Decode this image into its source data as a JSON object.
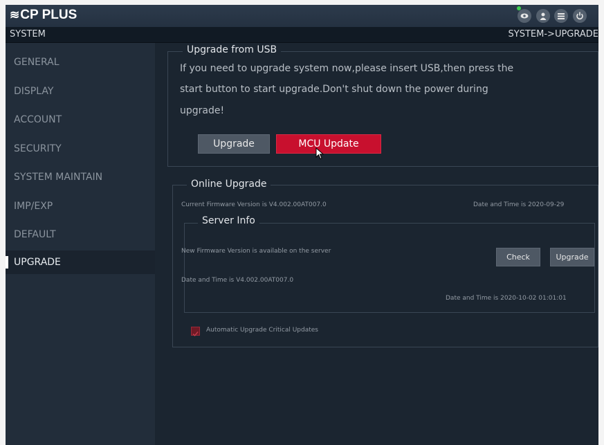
{
  "header": {
    "logo_text": "CP PLUS",
    "logo_mark": "≋",
    "icons": [
      "eye-icon",
      "user-icon",
      "menu-icon",
      "power-icon"
    ]
  },
  "subheader": {
    "section": "SYSTEM",
    "breadcrumb": "SYSTEM->UPGRADE"
  },
  "sidebar": {
    "items": [
      {
        "label": "GENERAL"
      },
      {
        "label": "DISPLAY"
      },
      {
        "label": "ACCOUNT"
      },
      {
        "label": "SECURITY"
      },
      {
        "label": "SYSTEM MAINTAIN"
      },
      {
        "label": "IMP/EXP"
      },
      {
        "label": "DEFAULT"
      },
      {
        "label": "UPGRADE",
        "active": true
      }
    ]
  },
  "usb_upgrade": {
    "title": "Upgrade from USB",
    "lines": [
      "If you need to upgrade system now,please insert USB,then press the",
      "start button to start upgrade.Don't shut down the power during",
      "upgrade!"
    ],
    "upgrade_button": "Upgrade",
    "mcu_button": "MCU Update"
  },
  "online_upgrade": {
    "title": "Online Upgrade",
    "current_firmware": "Current Firmware Version is V4.002.00AT007.0",
    "current_date": "Date and Time is 2020-09-29",
    "server_info": {
      "title": "Server Info",
      "new_firmware": "New Firmware Version is available on the server",
      "check_button": "Check",
      "upgrade_button": "Upgrade",
      "date_version": "Date and Time is  V4.002.00AT007.0",
      "server_date": "Date and Time is 2020-10-02 01:01:01"
    },
    "auto_upgrade_label": "Automatic Upgrade Critical Updates",
    "auto_upgrade_checked": true
  },
  "colors": {
    "accent_red": "#c8102e",
    "status_green": "#3fcf4f"
  }
}
